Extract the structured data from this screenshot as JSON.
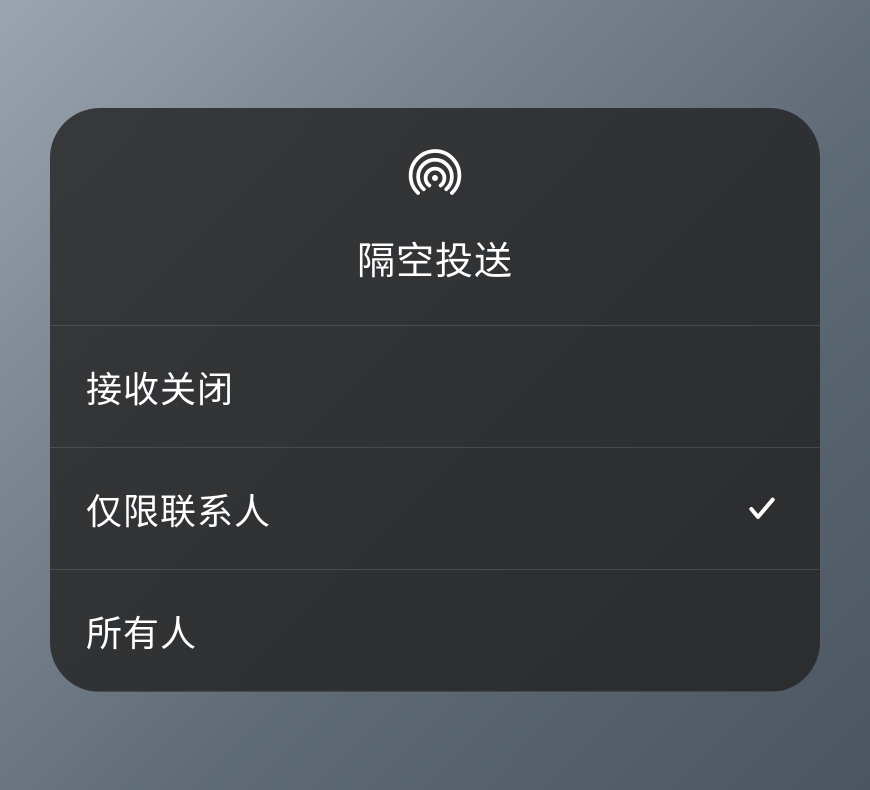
{
  "title": "隔空投送",
  "options": [
    {
      "label": "接收关闭",
      "selected": false
    },
    {
      "label": "仅限联系人",
      "selected": true
    },
    {
      "label": "所有人",
      "selected": false
    }
  ]
}
